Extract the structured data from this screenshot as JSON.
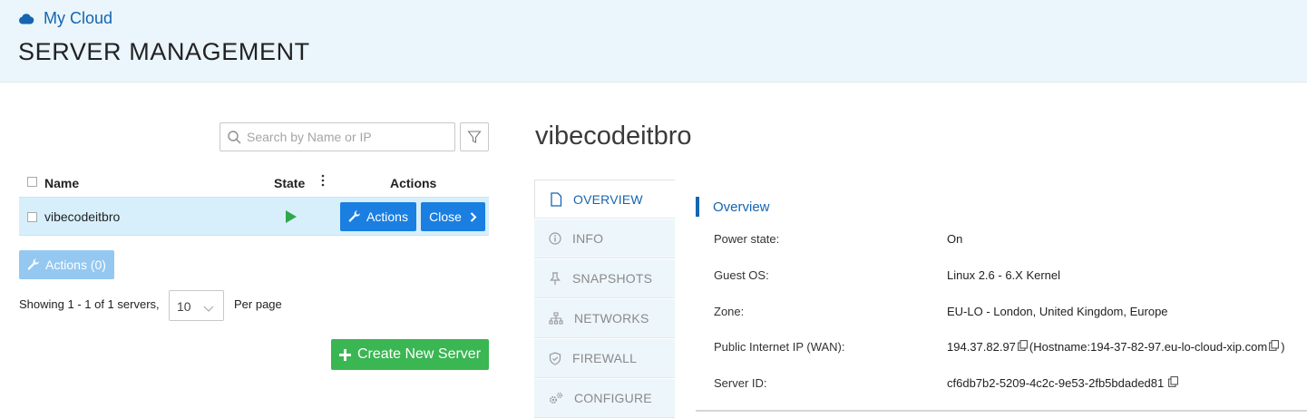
{
  "header": {
    "breadcrumb": "My Cloud",
    "title": "SERVER MANAGEMENT"
  },
  "list": {
    "search_placeholder": "Search by Name or IP",
    "columns": {
      "name": "Name",
      "state": "State",
      "actions": "Actions"
    },
    "rows": [
      {
        "name": "vibecodeitbro",
        "state": "running",
        "actions_label": "Actions",
        "close_label": "Close"
      }
    ],
    "bulk_actions_label": "Actions (0)",
    "showing_text": "Showing 1 - 1 of 1 servers,",
    "per_page_value": "10",
    "per_page_label": "Per page",
    "create_label": "Create New Server"
  },
  "detail": {
    "server_name": "vibecodeitbro",
    "tabs": [
      {
        "label": "OVERVIEW",
        "icon": "document-icon",
        "active": true
      },
      {
        "label": "INFO",
        "icon": "info-icon",
        "active": false
      },
      {
        "label": "SNAPSHOTS",
        "icon": "pin-icon",
        "active": false
      },
      {
        "label": "NETWORKS",
        "icon": "network-icon",
        "active": false
      },
      {
        "label": "FIREWALL",
        "icon": "shield-icon",
        "active": false
      },
      {
        "label": "CONFIGURE",
        "icon": "gears-icon",
        "active": false
      }
    ],
    "overview": {
      "title": "Overview",
      "power_state_label": "Power state:",
      "power_state_value": "On",
      "guest_os_label": "Guest OS:",
      "guest_os_value": "Linux 2.6 - 6.X Kernel",
      "zone_label": "Zone:",
      "zone_value": "EU-LO - London, United Kingdom, Europe",
      "wan_label": "Public Internet IP (WAN):",
      "wan_ip": "194.37.82.97",
      "wan_hostname_prefix": "(Hostname: ",
      "wan_hostname": "194-37-82-97.eu-lo-cloud-xip.com",
      "wan_hostname_suffix": ")",
      "server_id_label": "Server ID:",
      "server_id_value": "cf6db7b2-5209-4c2c-9e53-2fb5bdaded81"
    }
  },
  "colors": {
    "accent": "#1a7fe0",
    "brand_blue": "#1565b0",
    "create_green": "#3ab653",
    "running_green": "#2ea84a",
    "header_bg": "#eaf5fc"
  }
}
